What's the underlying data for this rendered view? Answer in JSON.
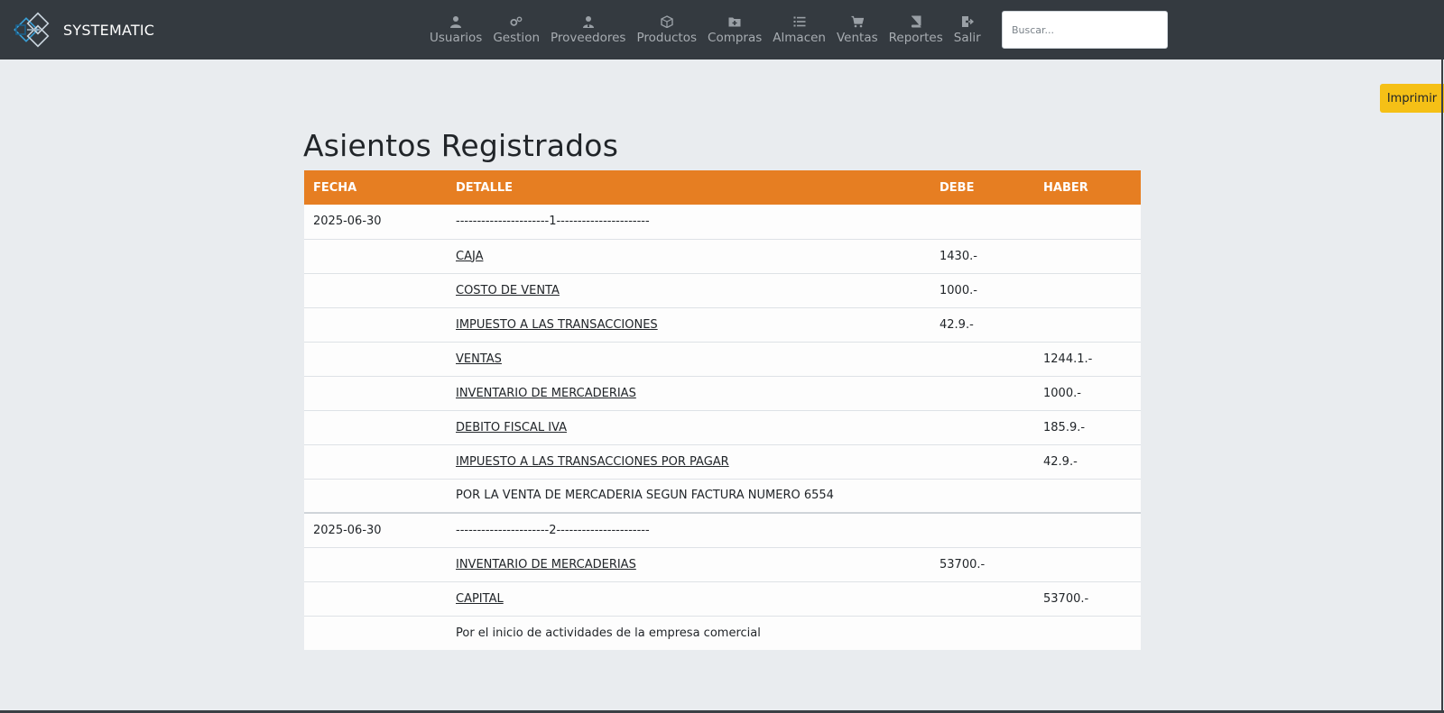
{
  "brand": {
    "name": "SYSTEMATIC"
  },
  "nav": [
    {
      "label": "Usuarios",
      "icon": "user-icon"
    },
    {
      "label": "Gestion",
      "icon": "gears-icon"
    },
    {
      "label": "Proveedores",
      "icon": "user-tie-icon"
    },
    {
      "label": "Productos",
      "icon": "box-icon"
    },
    {
      "label": "Compras",
      "icon": "folder-plus-icon"
    },
    {
      "label": "Almacen",
      "icon": "list-icon"
    },
    {
      "label": "Ventas",
      "icon": "cart-icon"
    },
    {
      "label": "Reportes",
      "icon": "book-icon"
    },
    {
      "label": "Salir",
      "icon": "sign-out-icon"
    }
  ],
  "search": {
    "placeholder": "Buscar..."
  },
  "print_button": "Imprimir",
  "page_title": "Asientos Registrados",
  "colors": {
    "navbar": "#343a40",
    "table_header": "#e67e22",
    "print_button": "#f5c016"
  },
  "table": {
    "headers": [
      "FECHA",
      "DETALLE",
      "DEBE",
      "HABER"
    ],
    "entries": [
      {
        "fecha": "2025-06-30",
        "numero": "----------------------1----------------------",
        "lines": [
          {
            "cuenta": "CAJA",
            "debe": "1430.-",
            "haber": ""
          },
          {
            "cuenta": "COSTO DE VENTA",
            "debe": "1000.-",
            "haber": ""
          },
          {
            "cuenta": "IMPUESTO A LAS TRANSACCIONES",
            "debe": "42.9.-",
            "haber": ""
          },
          {
            "cuenta": "VENTAS",
            "debe": "",
            "haber": "1244.1.-"
          },
          {
            "cuenta": "INVENTARIO DE MERCADERIAS",
            "debe": "",
            "haber": "1000.-"
          },
          {
            "cuenta": "DEBITO FISCAL IVA",
            "debe": "",
            "haber": "185.9.-"
          },
          {
            "cuenta": "IMPUESTO A LAS TRANSACCIONES POR PAGAR",
            "debe": "",
            "haber": "42.9.-"
          }
        ],
        "glosa": "POR LA VENTA DE MERCADERIA SEGUN FACTURA NUMERO 6554"
      },
      {
        "fecha": "2025-06-30",
        "numero": "----------------------2----------------------",
        "lines": [
          {
            "cuenta": "INVENTARIO DE MERCADERIAS",
            "debe": "53700.-",
            "haber": ""
          },
          {
            "cuenta": "CAPITAL",
            "debe": "",
            "haber": "53700.-"
          }
        ],
        "glosa": "Por el inicio de actividades de la empresa comercial"
      }
    ]
  }
}
